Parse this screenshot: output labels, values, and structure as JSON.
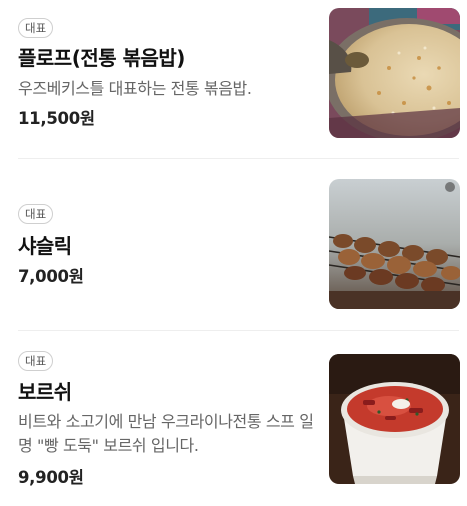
{
  "menu": {
    "items": [
      {
        "badge": "대표",
        "name": "플로프(전통 볶음밥)",
        "description": "우즈베키스틀 대표하는 전통 볶음밥.",
        "price": "11,500원"
      },
      {
        "badge": "대표",
        "name": "샤슬릭",
        "description": "",
        "price": "7,000원"
      },
      {
        "badge": "대표",
        "name": "보르쉬",
        "description": "비트와 소고기에 만남 우크라이나전통 스프 일명 \"빵 도둑\" 보르쉬 입니다.",
        "price": "9,900원"
      }
    ]
  }
}
